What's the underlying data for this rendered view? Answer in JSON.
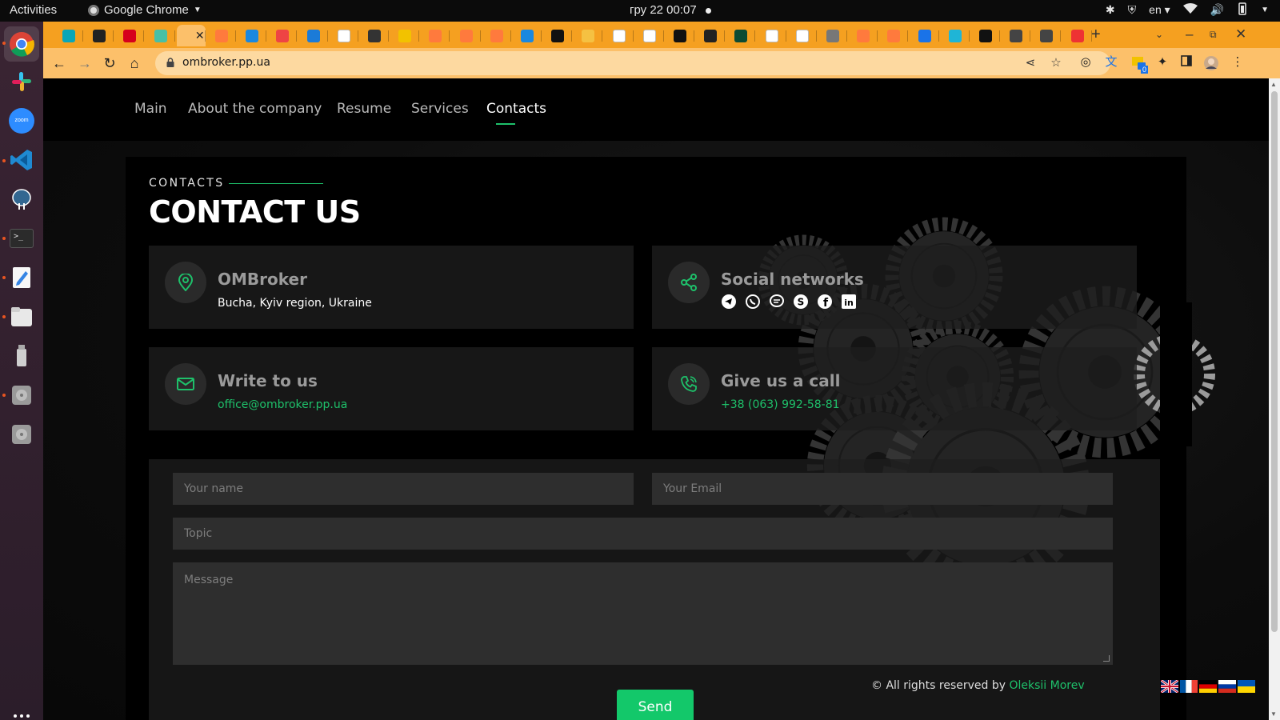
{
  "system": {
    "activities": "Activities",
    "app_name": "Google Chrome",
    "clock": "гру 22  00:07",
    "lang": "en"
  },
  "browser": {
    "url": "ombroker.pp.ua",
    "tab_favicon_colors": [
      "#0aa6b8",
      "#222",
      "#d6001c",
      "#48c0a5",
      "#fcc06a",
      "#ff7a3d",
      "#1a88e0",
      "#e44",
      "#1b7bd8",
      "#fff",
      "#333",
      "#f2c200",
      "#ff7a3d",
      "#ff7a3d",
      "#ff7a3d",
      "#1a88e0",
      "#111",
      "#f5c142",
      "#fff",
      "#fff",
      "#111",
      "#222",
      "#0c4b33",
      "#fff",
      "#fff",
      "#777",
      "#ff7a3d",
      "#ff7a3d",
      "#1a73e8",
      "#1fb5d6",
      "#111",
      "#444",
      "#444",
      "#e33"
    ],
    "download_badge": "0"
  },
  "site": {
    "nav": [
      "Main",
      "About the company",
      "Resume",
      "Services",
      "Contacts"
    ],
    "eyebrow": "CONTACTS",
    "title": "CONTACT US",
    "cards": {
      "company": {
        "title": "OMBroker",
        "text": "Bucha, Kyiv region, Ukraine",
        "icon": "map-pin-icon"
      },
      "social": {
        "title": "Social networks",
        "icon": "share-icon",
        "networks": [
          "telegram",
          "whatsapp",
          "messenger",
          "skype",
          "facebook",
          "linkedin"
        ]
      },
      "email": {
        "title": "Write to us",
        "link": "office@ombroker.pp.ua",
        "icon": "envelope-icon"
      },
      "phone": {
        "title": "Give us a call",
        "link": "+38 (063) 992-58-81",
        "icon": "phone-icon"
      }
    },
    "form": {
      "name_placeholder": "Your name",
      "email_placeholder": "Your Email",
      "topic_placeholder": "Topic",
      "message_placeholder": "Message",
      "send": "Send"
    },
    "footer": {
      "copyright": "© All rights reserved by ",
      "author": "Oleksii Morev"
    },
    "languages": [
      "en",
      "fr",
      "de",
      "ru",
      "uk"
    ],
    "accent_color": "#1ec06a"
  }
}
